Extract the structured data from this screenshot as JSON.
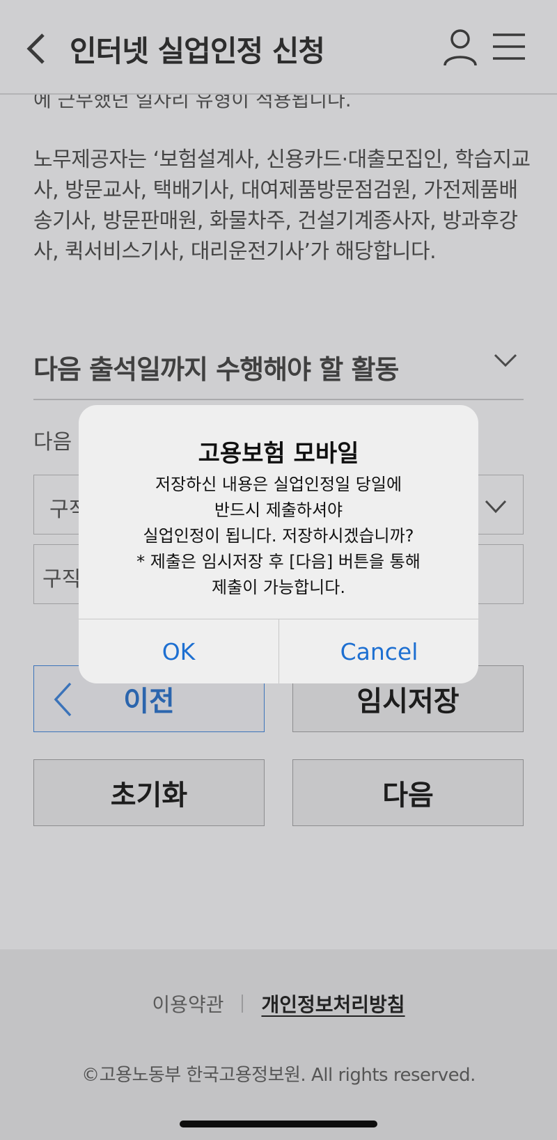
{
  "header": {
    "title": "인터넷 실업인정 신청"
  },
  "content": {
    "cut_line": "에 근무했던 일자리 유형이 적용됩니다.",
    "description": "노무제공자는 ‘보험설계사, 신용카드·대출모집인, 학습지교사, 방문교사, 택배기사, 대여제품방문점검원, 가전제품배송기사, 방문판매원, 화물차주, 건설기계종사자, 방과후강사, 퀵서비스기사, 대리운전기사’가 해당합니다.",
    "section_title": "다음 출석일까지 수행해야 할 활동",
    "sub_label": "다음 ·",
    "field_1_text": "구직",
    "field_2_text": "구직"
  },
  "buttons": {
    "prev": "이전",
    "temp_save": "임시저장",
    "reset": "초기화",
    "next": "다음"
  },
  "footer": {
    "terms": "이용약관",
    "privacy": "개인정보처리방침",
    "copyright": "©고용노동부 한국고용정보원. All rights reserved."
  },
  "alert": {
    "title": "고용보험 모바일",
    "message_lines": [
      "저장하신 내용은 실업인정일 당일에",
      "반드시 제출하셔야",
      "실업인정이 됩니다. 저장하시겠습니까?",
      "* 제출은 임시저장 후 [다음] 버튼을 통해",
      "제출이 가능합니다."
    ],
    "ok": "OK",
    "cancel": "Cancel"
  },
  "colors": {
    "background": "#cfcfd1",
    "accent_blue": "#1d6fd1",
    "prev_button_border": "#3b73b9",
    "alert_background": "#efefef"
  },
  "icons": {
    "back": "chevron-left-icon",
    "user": "user-icon",
    "menu": "hamburger-menu-icon",
    "section_toggle": "chevron-down-icon"
  }
}
